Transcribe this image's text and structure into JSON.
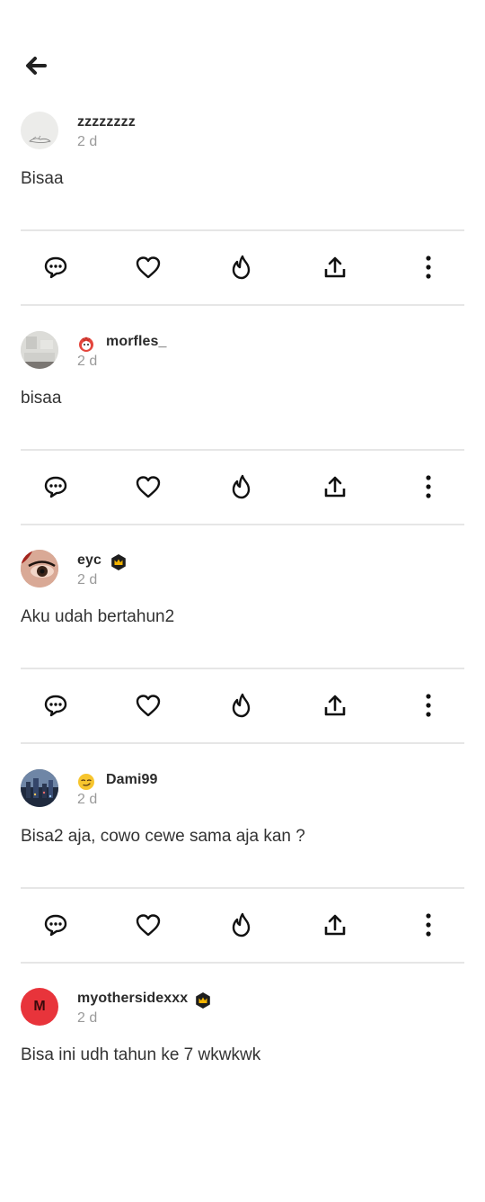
{
  "header": {
    "back_icon": "arrow-left-icon"
  },
  "posts": [
    {
      "username": "zzzzzzzz",
      "time": "2 d",
      "text": "Bisaa",
      "avatar_type": "sketch",
      "badge": ""
    },
    {
      "username": "morfles_",
      "time": "2 d",
      "text": "bisaa",
      "avatar_type": "photo-grey",
      "badge": "red-mascot-badge"
    },
    {
      "username": "eyc",
      "time": "2 d",
      "text": "Aku udah bertahun2",
      "avatar_type": "eye-photo",
      "badge": "crown-badge"
    },
    {
      "username": "Dami99",
      "time": "2 d",
      "text": "Bisa2 aja, cowo cewe sama aja kan ?",
      "avatar_type": "city-photo",
      "badge": "smirk-emoji-badge"
    },
    {
      "username": "myothersidexxx",
      "time": "2 d",
      "text": "Bisa ini udh tahun ke 7 wkwkwk",
      "avatar_type": "letter",
      "avatar_letter": "M",
      "badge": "crown-badge"
    }
  ],
  "actions": [
    "comment-icon",
    "heart-icon",
    "flame-icon",
    "share-icon",
    "more-vertical-icon"
  ],
  "colors": {
    "avatar_red": "#e8343b",
    "divider": "#e6e6e6",
    "muted": "#9a9a9a"
  }
}
